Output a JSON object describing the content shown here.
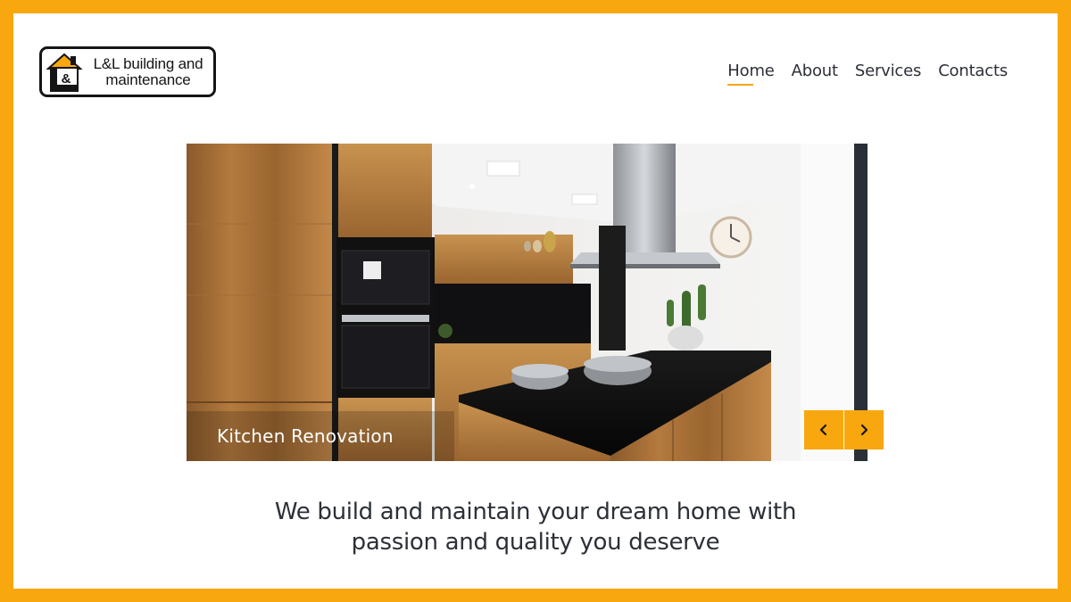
{
  "brand": {
    "logo_line1": "L&L building and",
    "logo_line2": "maintenance",
    "logo_icon_text": "&",
    "accent_color": "#f9a70e"
  },
  "nav": {
    "items": [
      {
        "label": "Home",
        "active": true
      },
      {
        "label": "About",
        "active": false
      },
      {
        "label": "Services",
        "active": false
      },
      {
        "label": "Contacts",
        "active": false
      }
    ]
  },
  "slider": {
    "caption": "Kitchen Renovation",
    "prev_icon": "chevron-left-icon",
    "next_icon": "chevron-right-icon"
  },
  "tagline": {
    "line1": "We build and maintain your dream home with",
    "line2": "passion and quality you deserve"
  }
}
